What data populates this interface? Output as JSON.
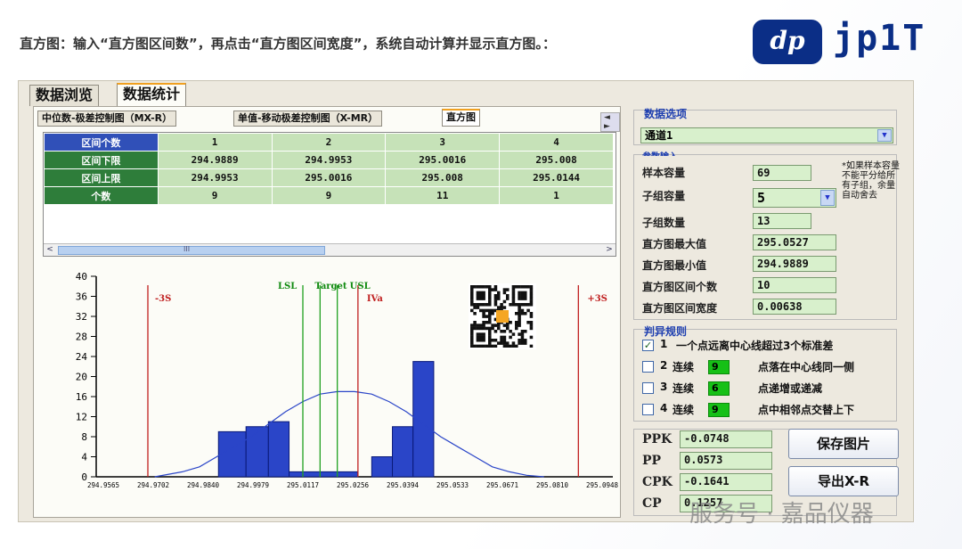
{
  "caption": "直方图：输入“直方图区间数”，再点击“直方图区间宽度”，系统自动计算并显示直方图。：",
  "logo": {
    "mark": "dp",
    "text": "jp1T"
  },
  "main_tabs": [
    "数据浏览",
    "数据统计"
  ],
  "sub_tabs": [
    "中位数-极差控制图（MX-R）",
    "单值-移动极差控制图（X-MR）",
    "直方图"
  ],
  "tab_arrows": "◄ ►",
  "table": {
    "headers": [
      "区间个数",
      "1",
      "2",
      "3",
      "4"
    ],
    "rows": [
      {
        "label": "区间下限",
        "values": [
          "294.9889",
          "294.9953",
          "295.0016",
          "295.008"
        ]
      },
      {
        "label": "区间上限",
        "values": [
          "294.9953",
          "295.0016",
          "295.008",
          "295.0144"
        ]
      },
      {
        "label": "个数",
        "values": [
          "9",
          "9",
          "11",
          "1"
        ]
      }
    ],
    "scroll_left": "<",
    "scroll_right": ">",
    "scroll_mid": "III"
  },
  "chart_data": {
    "type": "bar",
    "yticks": [
      0,
      4,
      8,
      12,
      16,
      20,
      24,
      28,
      32,
      36,
      40
    ],
    "ylim": [
      0,
      40
    ],
    "xticks": [
      "294.9565",
      "294.9702",
      "294.9840",
      "294.9979",
      "295.0117",
      "295.0256",
      "295.0394",
      "295.0533",
      "295.0671",
      "295.0810",
      "295.0948"
    ],
    "bars": [
      {
        "x0": 3.55,
        "x1": 4.35,
        "y": 9
      },
      {
        "x0": 4.35,
        "x1": 5.0,
        "y": 10
      },
      {
        "x0": 5.0,
        "x1": 5.6,
        "y": 11
      },
      {
        "x0": 5.6,
        "x1": 7.6,
        "y": 1
      },
      {
        "x0": 8.0,
        "x1": 8.6,
        "y": 4
      },
      {
        "x0": 8.6,
        "x1": 9.2,
        "y": 10
      },
      {
        "x0": 9.2,
        "x1": 9.8,
        "y": 23
      }
    ],
    "curve": [
      [
        1.7,
        0
      ],
      [
        2.5,
        1
      ],
      [
        3.0,
        2
      ],
      [
        3.5,
        4
      ],
      [
        4.0,
        6
      ],
      [
        4.5,
        8
      ],
      [
        5.0,
        10.5
      ],
      [
        5.5,
        13
      ],
      [
        6.0,
        15
      ],
      [
        6.5,
        16.5
      ],
      [
        7.0,
        17
      ],
      [
        7.5,
        17
      ],
      [
        8.0,
        16.5
      ],
      [
        8.5,
        15
      ],
      [
        9.0,
        13
      ],
      [
        9.5,
        10.5
      ],
      [
        10,
        8
      ],
      [
        10.5,
        6
      ],
      [
        11,
        4
      ],
      [
        11.5,
        2
      ],
      [
        12,
        1
      ],
      [
        12.5,
        0.3
      ],
      [
        13,
        0
      ]
    ],
    "vlines": [
      {
        "label": "-3S",
        "pos": 1.5,
        "color": "#c02020",
        "text_color": "#c02020"
      },
      {
        "label": "LSL",
        "pos": 6.0,
        "color": "#20a020",
        "text_color": "#108a10"
      },
      {
        "label": "Target",
        "pos": 6.5,
        "color": "#20a020",
        "text_color": "#108a10"
      },
      {
        "label": "USL",
        "pos": 7.0,
        "color": "#20a020",
        "text_color": "#108a10"
      },
      {
        "label": "IVa",
        "pos": 7.6,
        "color": "#c02020",
        "text_color": "#c02020"
      },
      {
        "label": "+3S",
        "pos": 14.0,
        "color": "#c02020",
        "text_color": "#c02020"
      }
    ],
    "bar_color": "#2a45c8",
    "curve_color": "#2a45c8"
  },
  "options": {
    "title": "数据选项",
    "channel": "通道1",
    "params_title": "参数输入",
    "fields": [
      {
        "label": "样本容量",
        "value": "69"
      },
      {
        "label": "子组容量",
        "value": "5"
      },
      {
        "label": "子组数量",
        "value": "13"
      },
      {
        "label": "直方图最大值",
        "value": "295.0527"
      },
      {
        "label": "直方图最小值",
        "value": "294.9889"
      },
      {
        "label": "直方图区间个数",
        "value": "10"
      },
      {
        "label": "直方图区间宽度",
        "value": "0.00638"
      }
    ],
    "note": "*如果样本容量不能平分给所有子组，余量自动舍去"
  },
  "rules": {
    "title": "判异规则",
    "items": [
      {
        "num": "1",
        "prefix": "",
        "count": "",
        "text": "一个点远离中心线超过3个标准差",
        "checked": true
      },
      {
        "num": "2",
        "prefix": "连续",
        "count": "9",
        "text": "点落在中心线同一侧",
        "checked": false
      },
      {
        "num": "3",
        "prefix": "连续",
        "count": "6",
        "text": "点递增或递减",
        "checked": false
      },
      {
        "num": "4",
        "prefix": "连续",
        "count": "9",
        "text": "点中相邻点交替上下",
        "checked": false
      }
    ]
  },
  "stats": [
    {
      "label": "PPK",
      "value": "-0.0748"
    },
    {
      "label": "PP",
      "value": "0.0573"
    },
    {
      "label": "CPK",
      "value": "-0.1641"
    },
    {
      "label": "CP",
      "value": "0.1257"
    }
  ],
  "buttons": {
    "save": "保存图片",
    "export": "导出X-R"
  },
  "watermark": "服务号 · 嘉品仪器"
}
